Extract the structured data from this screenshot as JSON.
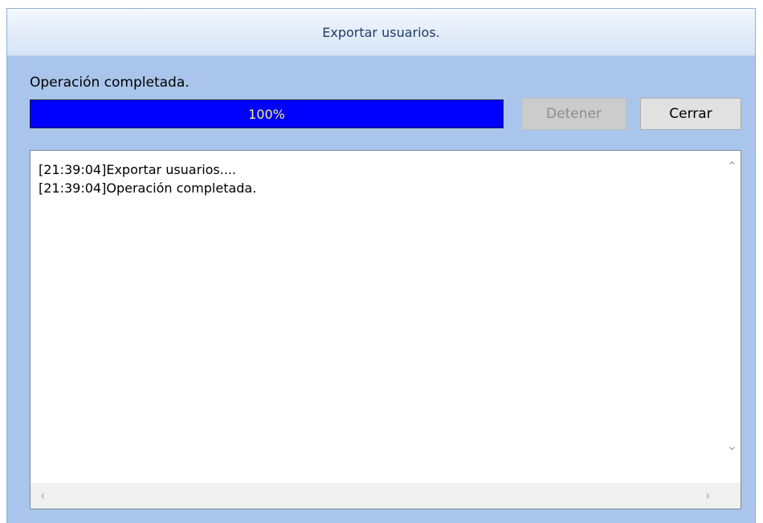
{
  "window": {
    "title": "Exportar usuarios."
  },
  "status": {
    "text": "Operación completada."
  },
  "progress": {
    "value_percent": 100,
    "label": "100%",
    "fill_color": "#0000ff",
    "text_color": "#f3f37a"
  },
  "buttons": {
    "stop_label": "Detener",
    "close_label": "Cerrar"
  },
  "log": {
    "lines": [
      "[21:39:04]Exportar usuarios....",
      "[21:39:04]Operación completada."
    ]
  },
  "scrollbar_icons": {
    "up": "chevron-up",
    "down": "chevron-down",
    "left": "chevron-left",
    "right": "chevron-right"
  }
}
